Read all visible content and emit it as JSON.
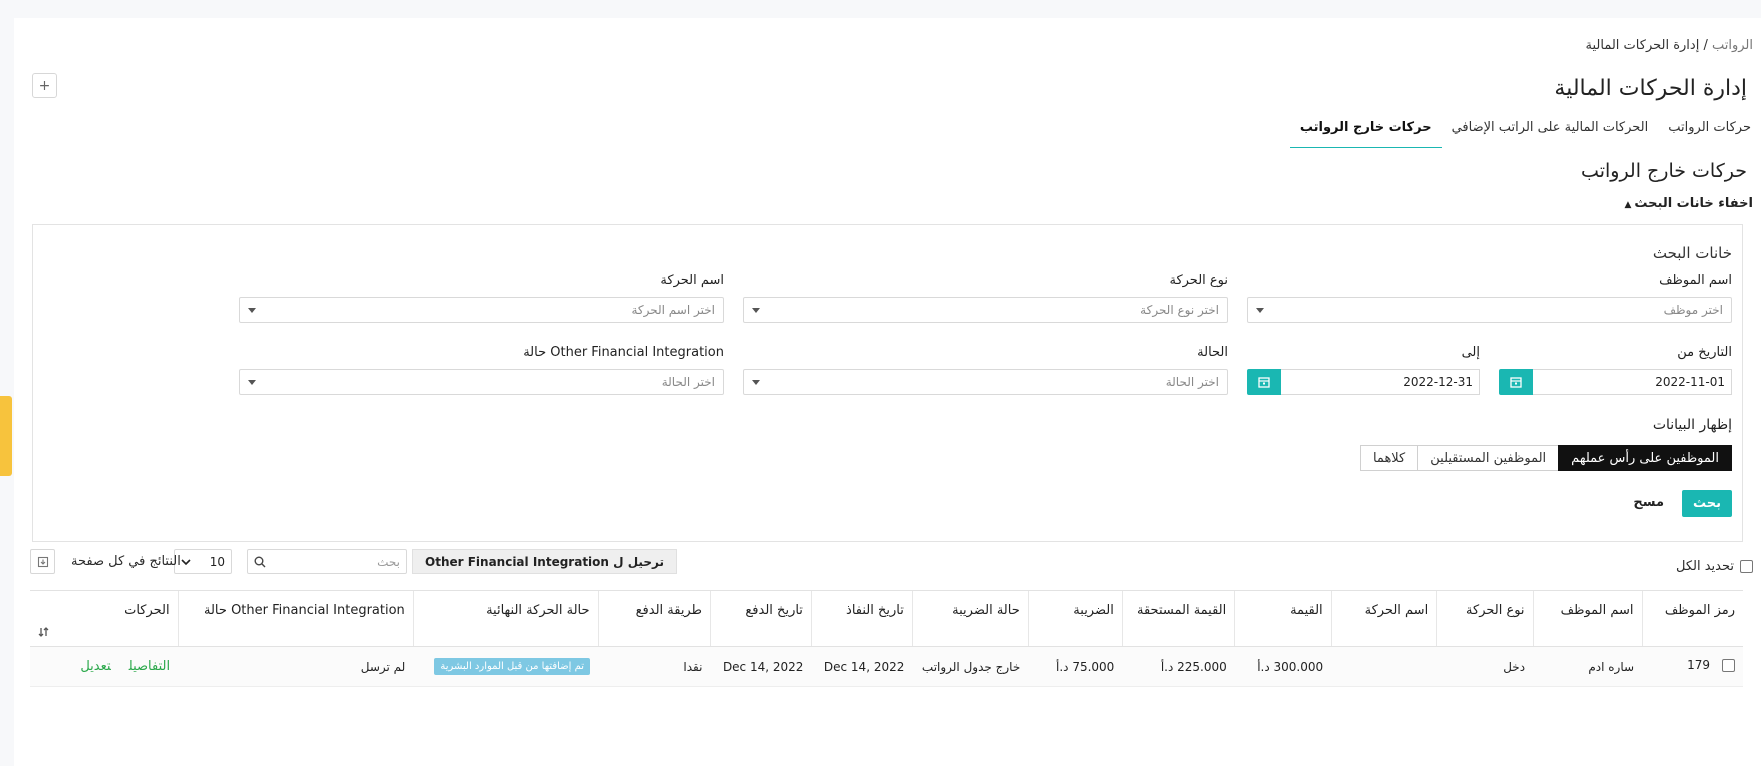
{
  "breadcrumb": {
    "root": "الرواتب",
    "separator": " / ",
    "current": "إدارة الحركات المالية"
  },
  "page_title": "إدارة الحركات المالية",
  "add_label": "+",
  "tabs": [
    {
      "label": "حركات الرواتب",
      "active": false
    },
    {
      "label": "الحركات المالية على الراتب الإضافي",
      "active": false
    },
    {
      "label": "حركات خارج الرواتب",
      "active": true
    }
  ],
  "section_title": "حركات خارج الرواتب",
  "toggle_search": "اخفاء خانات البحث",
  "search_panel": {
    "title": "خانات البحث",
    "employee_name": {
      "label": "اسم الموظف",
      "placeholder": "اختر موظف"
    },
    "movement_type": {
      "label": "نوع الحركة",
      "placeholder": "اختر نوع الحركة"
    },
    "movement_name": {
      "label": "اسم الحركة",
      "placeholder": "اختر اسم الحركة"
    },
    "date_from": {
      "label": "التاريخ من",
      "value": "2022-11-01"
    },
    "date_to": {
      "label": "إلى",
      "value": "2022-12-31"
    },
    "status": {
      "label": "الحالة",
      "placeholder": "اختر الحالة"
    },
    "ofi_status": {
      "label": "Other Financial Integration حالة",
      "placeholder": "اختر الحالة"
    },
    "show_data_title": "إظهار البيانات",
    "show_data_options": [
      {
        "label": "الموظفين على رأس عملهم",
        "active": true
      },
      {
        "label": "الموظفين المستقيلين",
        "active": false
      },
      {
        "label": "كلاهما",
        "active": false
      }
    ],
    "search_btn": "بحث",
    "clear_btn": "مسح"
  },
  "toolbar": {
    "select_all": "تحديد الكل",
    "export_btn": "ترحيل ل Other Financial Integration",
    "search_placeholder": "بحث",
    "per_page_value": "10",
    "per_page_label": "النتائج في كل صفحة"
  },
  "table": {
    "columns": [
      "رمز الموظف",
      "اسم الموظف",
      "نوع الحركة",
      "اسم الحركة",
      "القيمة",
      "القيمة المستحقة",
      "الضريبة",
      "حالة الضريبة",
      "تاريخ النفاذ",
      "تاريخ الدفع",
      "طريقة الدفع",
      "حالة الحركة النهائية",
      "Other Financial Integration حالة",
      "الحركات"
    ],
    "rows": [
      {
        "code": "179",
        "employee": "ساره ادم",
        "type": "دخل",
        "name": "",
        "value": "300.000 د.أ",
        "due": "225.000 د.أ",
        "tax": "75.000 د.أ",
        "tax_status": "خارج جدول الرواتب",
        "effective_date": "Dec 14, 2022",
        "payment_date": "Dec 14, 2022",
        "payment_method": "نقدا",
        "final_status": "تم إضافتها من قبل الموارد البشرية",
        "ofi_status": "لم ترسل",
        "action_details": "التفاصيل",
        "action_edit": "تعديل"
      }
    ]
  },
  "colors": {
    "accent": "#1ab7b2",
    "badge": "#7ec8e3",
    "link": "#2aa84a",
    "side_tab": "#f7c33d"
  }
}
